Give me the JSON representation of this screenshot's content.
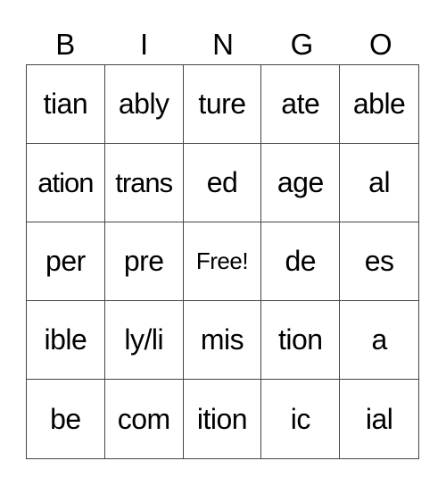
{
  "header": {
    "letters": [
      "B",
      "I",
      "N",
      "G",
      "O"
    ]
  },
  "board": {
    "rows": [
      [
        "tian",
        "ably",
        "ture",
        "ate",
        "able"
      ],
      [
        "ation",
        "trans",
        "ed",
        "age",
        "al"
      ],
      [
        "per",
        "pre",
        "Free!",
        "de",
        "es"
      ],
      [
        "ible",
        "ly/li",
        "mis",
        "tion",
        "a"
      ],
      [
        "be",
        "com",
        "ition",
        "ic",
        "ial"
      ]
    ],
    "free_space": {
      "row": 2,
      "col": 2,
      "label": "Free!"
    }
  }
}
